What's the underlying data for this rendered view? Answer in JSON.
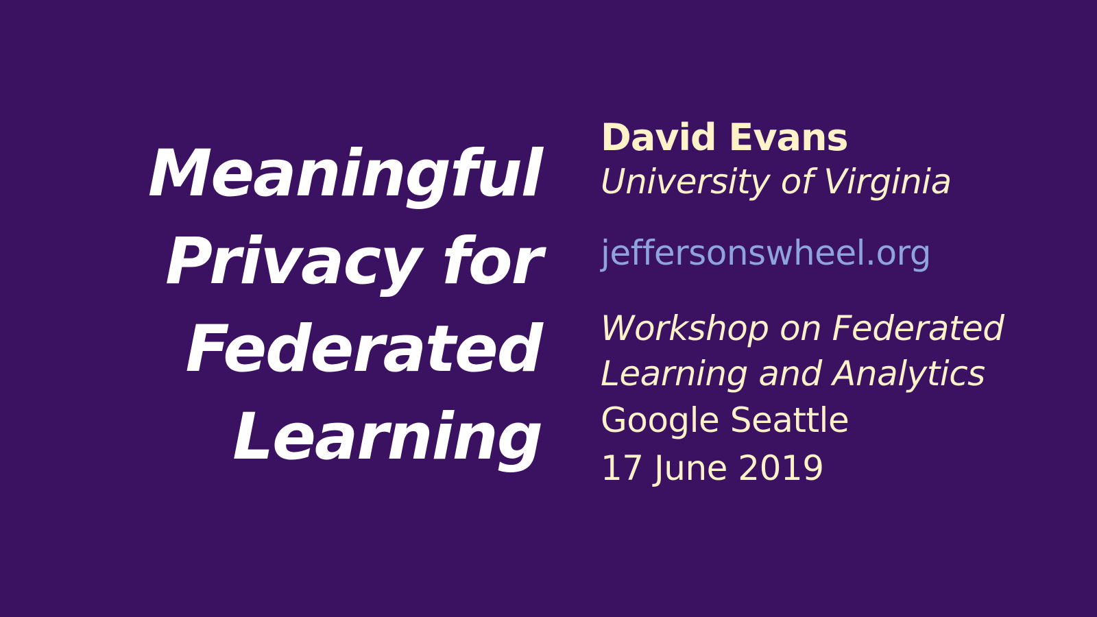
{
  "slide": {
    "background_color": "#3b1262",
    "title_lines": [
      "Meaningful",
      "Privacy for",
      "Federated",
      "Learning"
    ],
    "author": {
      "name": "David Evans",
      "affiliation": "University of Virginia"
    },
    "website": "jeffersonswheel.org",
    "event": {
      "name_lines": [
        "Workshop on Federated",
        "Learning and Analytics"
      ],
      "venue": "Google Seattle",
      "date": "17 June 2019"
    },
    "colors": {
      "title": "#ffffff",
      "author_text": "#fff1c8",
      "link": "#8fa4de"
    }
  }
}
